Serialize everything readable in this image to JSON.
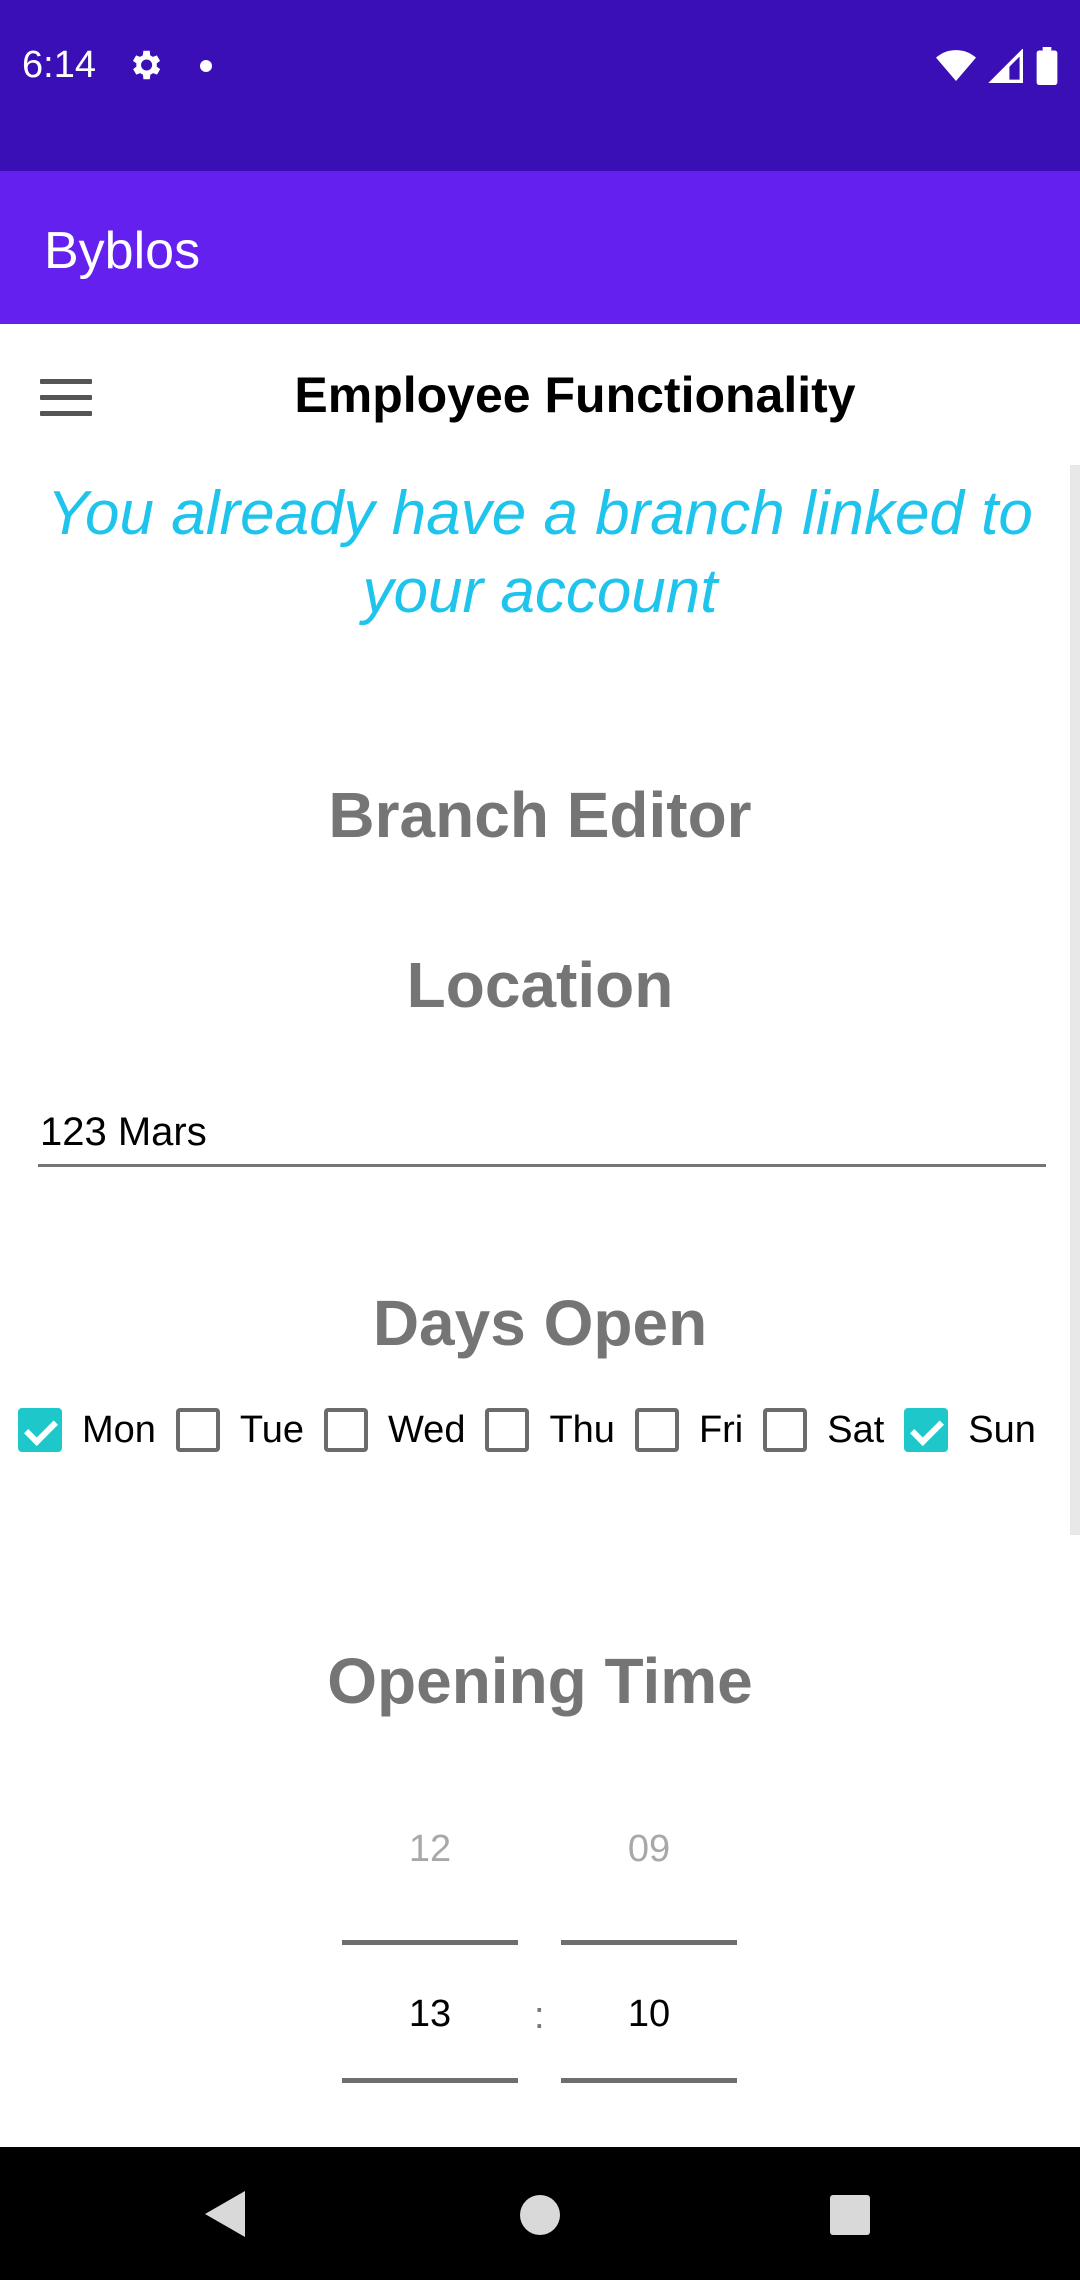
{
  "status_bar": {
    "time": "6:14",
    "icons": [
      "gear-icon",
      "notification-dot-icon",
      "wifi-icon",
      "signal-icon",
      "battery-icon"
    ]
  },
  "app_bar": {
    "title": "Byblos"
  },
  "toolbar": {
    "title": "Employee Functionality",
    "menu_icon": "hamburger-menu-icon"
  },
  "notice": "You already have a branch linked to your account",
  "headings": {
    "branch_editor": "Branch Editor",
    "location": "Location",
    "days_open": "Days Open",
    "opening_time": "Opening Time"
  },
  "location_field": {
    "value": "123 Mars"
  },
  "days": [
    {
      "label": "Mon",
      "checked": true
    },
    {
      "label": "Tue",
      "checked": false
    },
    {
      "label": "Wed",
      "checked": false
    },
    {
      "label": "Thu",
      "checked": false
    },
    {
      "label": "Fri",
      "checked": false
    },
    {
      "label": "Sat",
      "checked": false
    },
    {
      "label": "Sun",
      "checked": true
    }
  ],
  "opening_time": {
    "hour_prev": "12",
    "hour": "13",
    "separator": ":",
    "minute_prev": "09",
    "minute": "10"
  },
  "colors": {
    "status_bar": "#3a0fb6",
    "app_bar": "#6420ee",
    "notice": "#1fc4ec",
    "checkbox_checked": "#1ec7c9",
    "heading": "#757575"
  }
}
